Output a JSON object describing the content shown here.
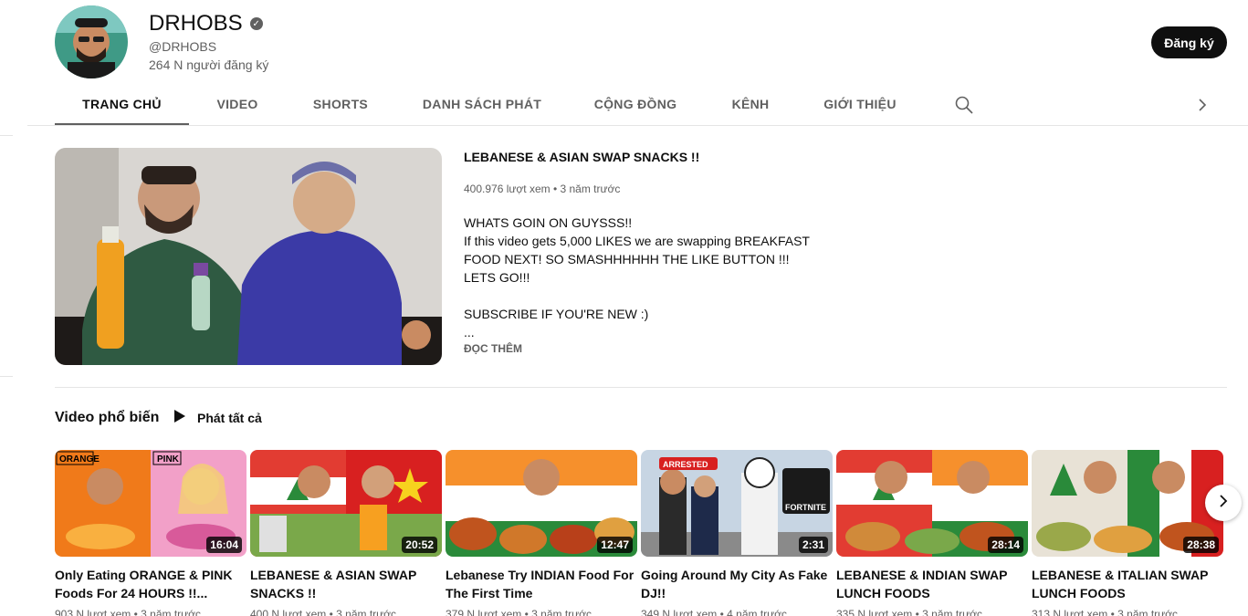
{
  "channel": {
    "name": "DRHOBS",
    "handle": "@DRHOBS",
    "subscribers": "264 N người đăng ký",
    "subscribe_label": "Đăng ký"
  },
  "tabs": [
    {
      "label": "TRANG CHỦ",
      "active": true
    },
    {
      "label": "VIDEO"
    },
    {
      "label": "SHORTS"
    },
    {
      "label": "DANH SÁCH PHÁT"
    },
    {
      "label": "CỘNG ĐỒNG"
    },
    {
      "label": "KÊNH"
    },
    {
      "label": "GIỚI THIỆU"
    }
  ],
  "featured": {
    "title": "LEBANESE & ASIAN SWAP SNACKS !!",
    "meta": "400.976 lượt xem • 3 năm trước",
    "description": [
      "WHATS GOIN ON GUYSSS!!",
      "If this video gets 5,000 LIKES we are swapping BREAKFAST FOOD NEXT! SO SMASHHHHHH THE LIKE BUTTON !!! LETS GO!!!",
      "",
      "SUBSCRIBE IF YOU'RE NEW :)",
      "..."
    ],
    "more_label": "ĐỌC THÊM"
  },
  "shelf": {
    "title": "Video phổ biến",
    "play_all": "Phát tất cả",
    "videos": [
      {
        "title": "Only Eating ORANGE & PINK Foods For 24 HOURS !!...",
        "duration": "16:04",
        "meta": "903 N lượt xem • 3 năm trước",
        "thumb_text_a": "ORANGE",
        "thumb_text_b": "PINK",
        "color_a": "#f07a1a",
        "color_b": "#f2a0c8"
      },
      {
        "title": "LEBANESE & ASIAN SWAP SNACKS !!",
        "duration": "20:52",
        "meta": "400 N lượt xem • 3 năm trước",
        "color_a": "#e23c32",
        "color_b": "#d82020"
      },
      {
        "title": "Lebanese Try INDIAN Food For The First Time",
        "duration": "12:47",
        "meta": "379 N lượt xem • 3 năm trước",
        "color_a": "#f6902c",
        "color_b": "#e8e0d0"
      },
      {
        "title": "Going Around My City As Fake DJ!!",
        "duration": "2:31",
        "meta": "349 N lượt xem • 4 năm trước",
        "thumb_text_a": "ARRESTED",
        "thumb_text_b": "FORTNITE",
        "color_a": "#9fb7cf",
        "color_b": "#dfe7ef"
      },
      {
        "title": "LEBANESE & INDIAN SWAP LUNCH FOODS",
        "duration": "28:14",
        "meta": "335 N lượt xem • 3 năm trước",
        "color_a": "#d4b088",
        "color_b": "#f0a040"
      },
      {
        "title": "LEBANESE & ITALIAN SWAP LUNCH FOODS",
        "duration": "28:38",
        "meta": "313 N lượt xem • 3 năm trước",
        "color_a": "#d9d1c4",
        "color_b": "#3c9a4a"
      }
    ]
  }
}
